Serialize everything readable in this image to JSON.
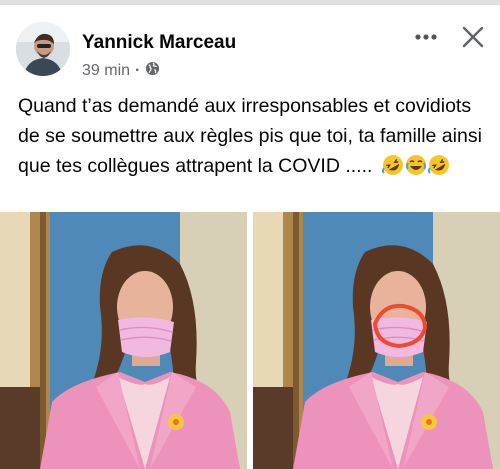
{
  "post": {
    "author": "Yannick Marceau",
    "time": "39 min",
    "separator": "·",
    "audience_icon": "globe-icon",
    "text": "Quand t’as demandé aux irresponsables et covidiots de se soumettre aux règles pis que toi, ta famille ainsi que tes collègues attrapent la COVID .....",
    "emojis": [
      "🤣",
      "😂",
      "🤣"
    ],
    "actions": {
      "more_icon": "more-options-icon",
      "close_icon": "close-icon"
    }
  },
  "photos": [
    {
      "description_icon": "photo-woman-mask-on-chin"
    },
    {
      "description_icon": "photo-woman-mask-circled-red"
    }
  ],
  "colors": {
    "meta_text": "#65676b",
    "blazer_pink": "#e98fb5",
    "mask_pink": "#efb3dd",
    "circle_red": "#f04a2e"
  }
}
